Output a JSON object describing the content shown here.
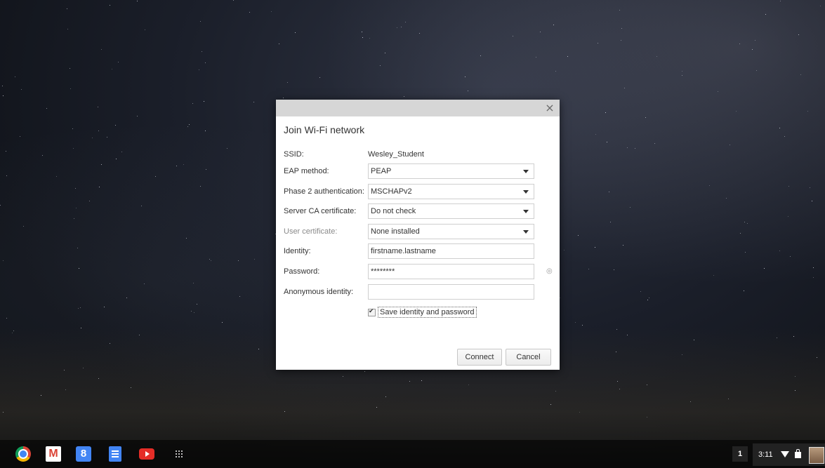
{
  "dialog": {
    "title": "Join Wi-Fi network",
    "close_symbol": "×",
    "fields": {
      "ssid": {
        "label": "SSID:",
        "value": "Wesley_Student"
      },
      "eap": {
        "label": "EAP method:",
        "value": "PEAP"
      },
      "phase2": {
        "label": "Phase 2 authentication:",
        "value": "MSCHAPv2"
      },
      "server_ca": {
        "label": "Server CA certificate:",
        "value": "Do not check"
      },
      "user_cert": {
        "label": "User certificate:",
        "value": "None installed"
      },
      "identity": {
        "label": "Identity:",
        "value": "firstname.lastname"
      },
      "password": {
        "label": "Password:",
        "value": "********"
      },
      "anon": {
        "label": "Anonymous identity:",
        "value": ""
      }
    },
    "save_label": "Save identity and password",
    "connect_label": "Connect",
    "cancel_label": "Cancel"
  },
  "shelf": {
    "apps": [
      "chrome-icon",
      "gmail-icon",
      "search-icon",
      "docs-icon",
      "youtube-icon",
      "launcher-icon"
    ],
    "notification_count": "1",
    "clock": "3:11"
  }
}
